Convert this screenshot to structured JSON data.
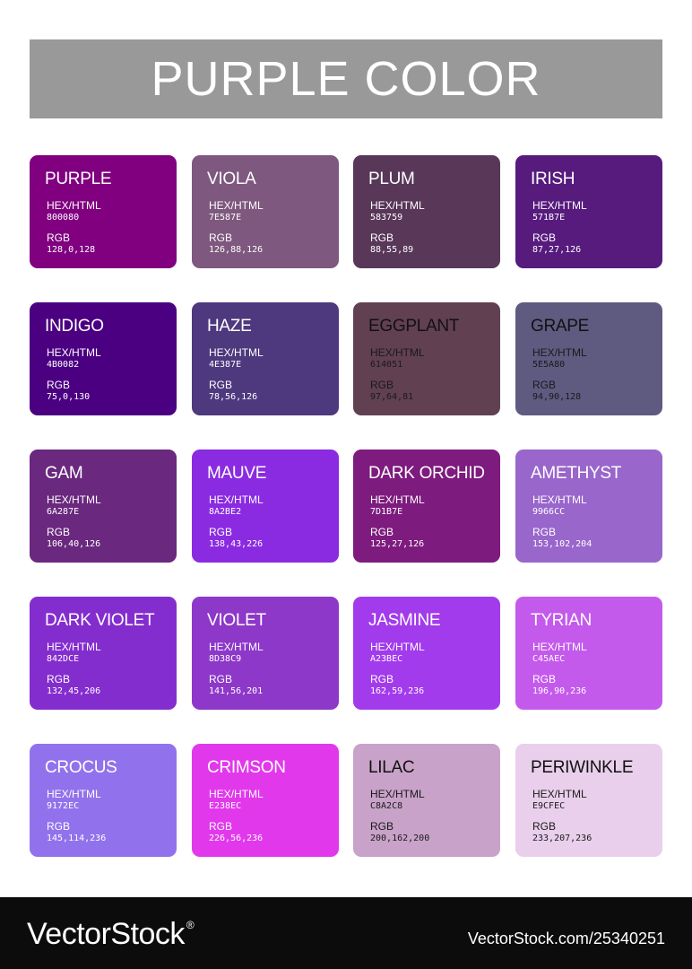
{
  "title": "PURPLE COLOR",
  "hex_label": "HEX/HTML",
  "rgb_label": "RGB",
  "colors": [
    {
      "name": "PURPLE",
      "hex": "800080",
      "rgb": "128,0,128",
      "bg": "#800080"
    },
    {
      "name": "VIOLA",
      "hex": "7E587E",
      "rgb": "126,88,126",
      "bg": "#7E587E"
    },
    {
      "name": "PLUM",
      "hex": "583759",
      "rgb": "88,55,89",
      "bg": "#583759"
    },
    {
      "name": "IRISH",
      "hex": "571B7E",
      "rgb": "87,27,126",
      "bg": "#571B7E"
    },
    {
      "name": "INDIGO",
      "hex": "4B0082",
      "rgb": "75,0,130",
      "bg": "#4B0082"
    },
    {
      "name": "HAZE",
      "hex": "4E387E",
      "rgb": "78,56,126",
      "bg": "#4E387E"
    },
    {
      "name": "EGGPLANT",
      "hex": "614051",
      "rgb": "97,64,81",
      "bg": "#614051"
    },
    {
      "name": "GRAPE",
      "hex": "5E5A80",
      "rgb": "94,90,128",
      "bg": "#5E5A80"
    },
    {
      "name": "GAM",
      "hex": "6A287E",
      "rgb": "106,40,126",
      "bg": "#6A287E"
    },
    {
      "name": "MAUVE",
      "hex": "8A2BE2",
      "rgb": "138,43,226",
      "bg": "#8A2BE2"
    },
    {
      "name": "DARK ORCHID",
      "hex": "7D1B7E",
      "rgb": "125,27,126",
      "bg": "#7D1B7E"
    },
    {
      "name": "AMETHYST",
      "hex": "9966CC",
      "rgb": "153,102,204",
      "bg": "#9966CC"
    },
    {
      "name": "DARK VIOLET",
      "hex": "842DCE",
      "rgb": "132,45,206",
      "bg": "#842DCE"
    },
    {
      "name": "VIOLET",
      "hex": "8D38C9",
      "rgb": "141,56,201",
      "bg": "#8D38C9"
    },
    {
      "name": "JASMINE",
      "hex": "A23BEC",
      "rgb": "162,59,236",
      "bg": "#A23BEC"
    },
    {
      "name": "TYRIAN",
      "hex": "C45AEC",
      "rgb": "196,90,236",
      "bg": "#C45AEC"
    },
    {
      "name": "CROCUS",
      "hex": "9172EC",
      "rgb": "145,114,236",
      "bg": "#9172EC"
    },
    {
      "name": "CRIMSON",
      "hex": "E238EC",
      "rgb": "226,56,236",
      "bg": "#E238EC"
    },
    {
      "name": "LILAC",
      "hex": "C8A2C8",
      "rgb": "200,162,200",
      "bg": "#C8A2C8"
    },
    {
      "name": "PERIWINKLE",
      "hex": "E9CFEC",
      "rgb": "233,207,236",
      "bg": "#E9CFEC"
    }
  ],
  "footer": {
    "logo": "VectorStock",
    "logo_mark": "®",
    "url": "VectorStock.com/25340251"
  }
}
